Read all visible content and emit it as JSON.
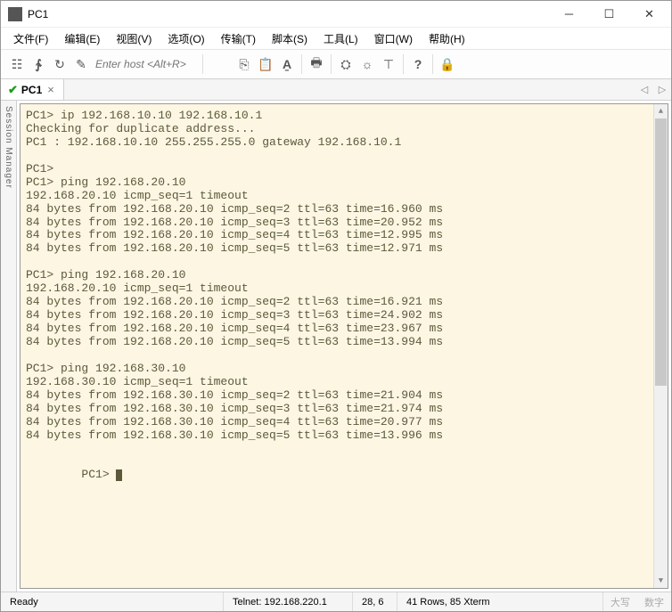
{
  "window": {
    "title": "PC1"
  },
  "menu": {
    "file": "文件(F)",
    "edit": "编辑(E)",
    "view": "视图(V)",
    "options": "选项(O)",
    "transfer": "传输(T)",
    "script": "脚本(S)",
    "tools": "工具(L)",
    "window": "窗口(W)",
    "help": "帮助(H)"
  },
  "toolbar": {
    "host_placeholder": "Enter host <Alt+R>"
  },
  "tab": {
    "name": "PC1"
  },
  "side_panel": "Session Manager",
  "terminal_lines": [
    "PC1> ip 192.168.10.10 192.168.10.1",
    "Checking for duplicate address...",
    "PC1 : 192.168.10.10 255.255.255.0 gateway 192.168.10.1",
    "",
    "PC1>",
    "PC1> ping 192.168.20.10",
    "192.168.20.10 icmp_seq=1 timeout",
    "84 bytes from 192.168.20.10 icmp_seq=2 ttl=63 time=16.960 ms",
    "84 bytes from 192.168.20.10 icmp_seq=3 ttl=63 time=20.952 ms",
    "84 bytes from 192.168.20.10 icmp_seq=4 ttl=63 time=12.995 ms",
    "84 bytes from 192.168.20.10 icmp_seq=5 ttl=63 time=12.971 ms",
    "",
    "PC1> ping 192.168.20.10",
    "192.168.20.10 icmp_seq=1 timeout",
    "84 bytes from 192.168.20.10 icmp_seq=2 ttl=63 time=16.921 ms",
    "84 bytes from 192.168.20.10 icmp_seq=3 ttl=63 time=24.902 ms",
    "84 bytes from 192.168.20.10 icmp_seq=4 ttl=63 time=23.967 ms",
    "84 bytes from 192.168.20.10 icmp_seq=5 ttl=63 time=13.994 ms",
    "",
    "PC1> ping 192.168.30.10",
    "192.168.30.10 icmp_seq=1 timeout",
    "84 bytes from 192.168.30.10 icmp_seq=2 ttl=63 time=21.904 ms",
    "84 bytes from 192.168.30.10 icmp_seq=3 ttl=63 time=21.974 ms",
    "84 bytes from 192.168.30.10 icmp_seq=4 ttl=63 time=20.977 ms",
    "84 bytes from 192.168.30.10 icmp_seq=5 ttl=63 time=13.996 ms",
    "",
    "PC1> "
  ],
  "status": {
    "ready": "Ready",
    "connection": "Telnet: 192.168.220.1",
    "position": "28,  6",
    "terminal": "41 Rows, 85  Xterm",
    "caps": "大写",
    "num": "数字"
  }
}
